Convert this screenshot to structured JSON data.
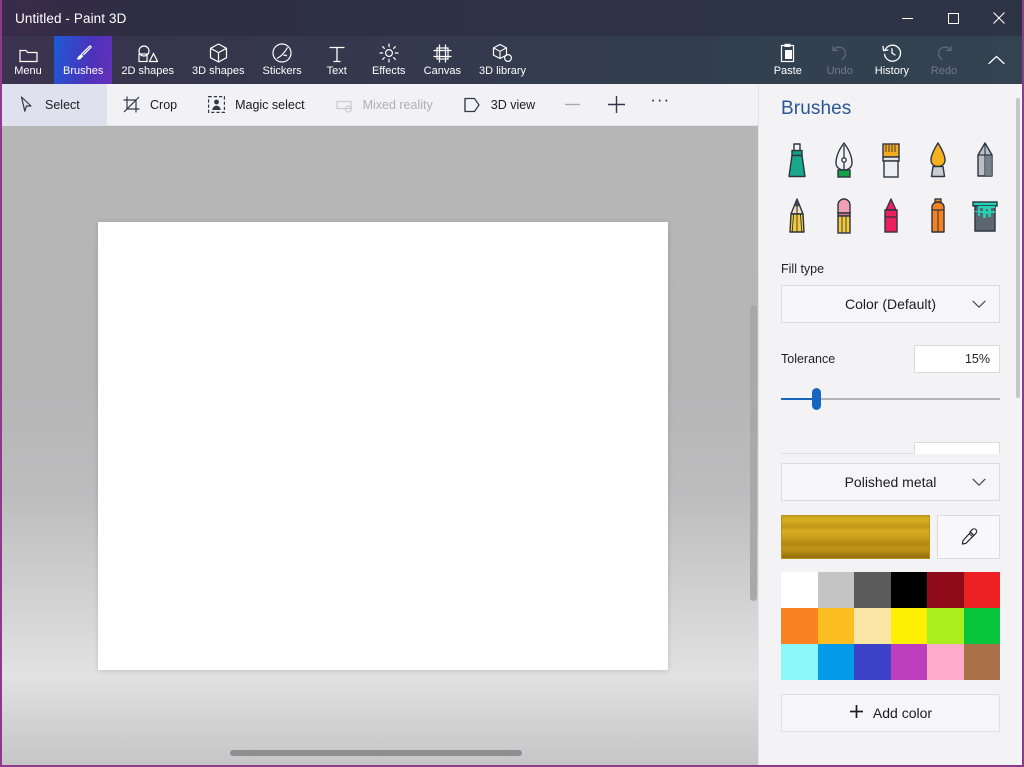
{
  "window": {
    "title": "Untitled - Paint 3D",
    "controls": [
      {
        "name": "minimize",
        "glyph": "minimize-icon"
      },
      {
        "name": "maximize",
        "glyph": "maximize-icon"
      },
      {
        "name": "close",
        "glyph": "close-icon"
      }
    ]
  },
  "ribbon": {
    "items": [
      {
        "label": "Menu",
        "icon": "folder-icon",
        "active": false,
        "disabled": false
      },
      {
        "label": "Brushes",
        "icon": "brush-icon",
        "active": true,
        "disabled": false
      },
      {
        "label": "2D shapes",
        "icon": "2d-shapes-icon",
        "active": false,
        "disabled": false
      },
      {
        "label": "3D shapes",
        "icon": "3d-shapes-icon",
        "active": false,
        "disabled": false
      },
      {
        "label": "Stickers",
        "icon": "stickers-icon",
        "active": false,
        "disabled": false
      },
      {
        "label": "Text",
        "icon": "text-icon",
        "active": false,
        "disabled": false
      },
      {
        "label": "Effects",
        "icon": "effects-icon",
        "active": false,
        "disabled": false
      },
      {
        "label": "Canvas",
        "icon": "canvas-icon",
        "active": false,
        "disabled": false
      },
      {
        "label": "3D library",
        "icon": "3d-library-icon",
        "active": false,
        "disabled": false
      }
    ],
    "right_items": [
      {
        "label": "Paste",
        "icon": "clipboard-icon",
        "disabled": false
      },
      {
        "label": "Undo",
        "icon": "undo-icon",
        "disabled": true
      },
      {
        "label": "History",
        "icon": "history-icon",
        "disabled": false
      },
      {
        "label": "Redo",
        "icon": "redo-icon",
        "disabled": true
      }
    ],
    "collapse_icon": "chevron-up-icon"
  },
  "toolbar": {
    "items": [
      {
        "label": "Select",
        "icon": "cursor-icon",
        "active": true,
        "disabled": false
      },
      {
        "label": "Crop",
        "icon": "crop-icon",
        "active": false,
        "disabled": false
      },
      {
        "label": "Magic select",
        "icon": "magic-select-icon",
        "active": false,
        "disabled": false
      },
      {
        "label": "Mixed reality",
        "icon": "mixed-reality-icon",
        "active": false,
        "disabled": true
      },
      {
        "label": "3D view",
        "icon": "3d-view-icon",
        "active": false,
        "disabled": false
      }
    ],
    "zoom_out": "minus-icon",
    "zoom_in": "plus-icon",
    "more": "···"
  },
  "panel": {
    "title": "Brushes",
    "brushes": [
      {
        "name": "marker",
        "label": "Marker"
      },
      {
        "name": "calligraphy-pen",
        "label": "Calligraphy pen"
      },
      {
        "name": "oil-brush",
        "label": "Oil brush"
      },
      {
        "name": "watercolor",
        "label": "Watercolor"
      },
      {
        "name": "pixel-pen",
        "label": "Pixel pen"
      },
      {
        "name": "pencil",
        "label": "Pencil"
      },
      {
        "name": "eraser",
        "label": "Eraser"
      },
      {
        "name": "crayon",
        "label": "Crayon"
      },
      {
        "name": "spray-can",
        "label": "Spray can"
      },
      {
        "name": "fill-bucket",
        "label": "Fill"
      }
    ],
    "fill_type_label": "Fill type",
    "fill_type_value": "Color (Default)",
    "tolerance_label": "Tolerance",
    "tolerance_value": "15%",
    "tolerance_percent": 15,
    "material_value": "Polished metal",
    "material_swatch_color": "#c9a21a",
    "eyedropper_icon": "eyedropper-icon",
    "palette": [
      [
        "#ffffff",
        "#c4c4c4",
        "#5b5b5b",
        "#000000",
        "#8f0b1a",
        "#ed2024"
      ],
      [
        "#f98121",
        "#fcbd21",
        "#f9e5a5",
        "#fdf002",
        "#a9ef1f",
        "#07c63e"
      ],
      [
        "#8cf7fb",
        "#049bea",
        "#3d43c9",
        "#bc3fbe",
        "#fcacc9",
        "#a9714a"
      ]
    ],
    "add_color_label": "Add color",
    "add_color_icon": "plus-icon"
  }
}
